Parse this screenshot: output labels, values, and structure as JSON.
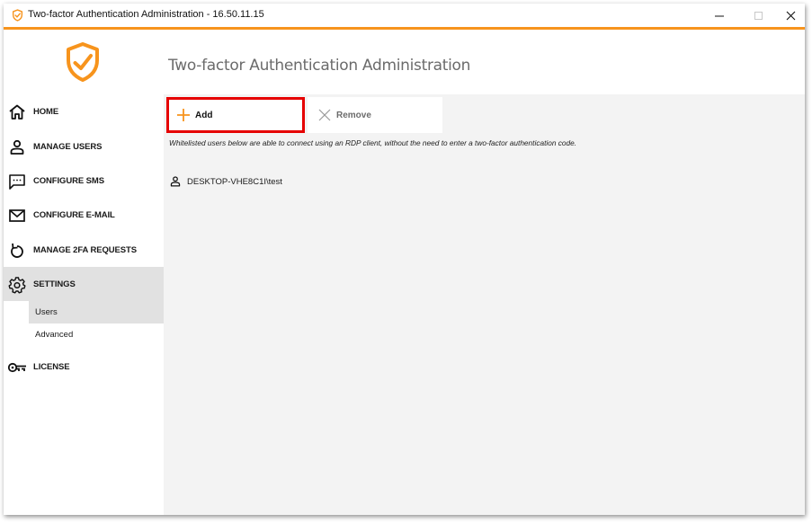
{
  "window": {
    "title": "Two-factor Authentication Administration - 16.50.11.15",
    "controls": {
      "minimize": "minimize",
      "maximize": "maximize",
      "close": "close"
    },
    "accent_color": "#f7941d"
  },
  "sidebar": {
    "logo_icon": "shield-check-icon",
    "items": [
      {
        "label": "HOME",
        "icon": "home-icon"
      },
      {
        "label": "MANAGE USERS",
        "icon": "user-icon"
      },
      {
        "label": "CONFIGURE SMS",
        "icon": "message-icon"
      },
      {
        "label": "CONFIGURE E-MAIL",
        "icon": "mail-icon"
      },
      {
        "label": "MANAGE 2FA REQUESTS",
        "icon": "refresh-icon"
      },
      {
        "label": "SETTINGS",
        "icon": "gear-icon",
        "active": true,
        "children": [
          {
            "label": "Users",
            "active": true
          },
          {
            "label": "Advanced",
            "active": false
          }
        ]
      },
      {
        "label": "LICENSE",
        "icon": "key-icon"
      }
    ]
  },
  "main": {
    "title": "Two-factor Authentication Administration",
    "toolbar": {
      "add_label": "Add",
      "remove_label": "Remove",
      "highlight_color": "#e60000"
    },
    "info_text": "Whitelisted users below are able to connect using an RDP client, without the need to enter a two-factor authentication code.",
    "users": [
      {
        "name": "DESKTOP-VHE8C1I\\test"
      }
    ]
  }
}
